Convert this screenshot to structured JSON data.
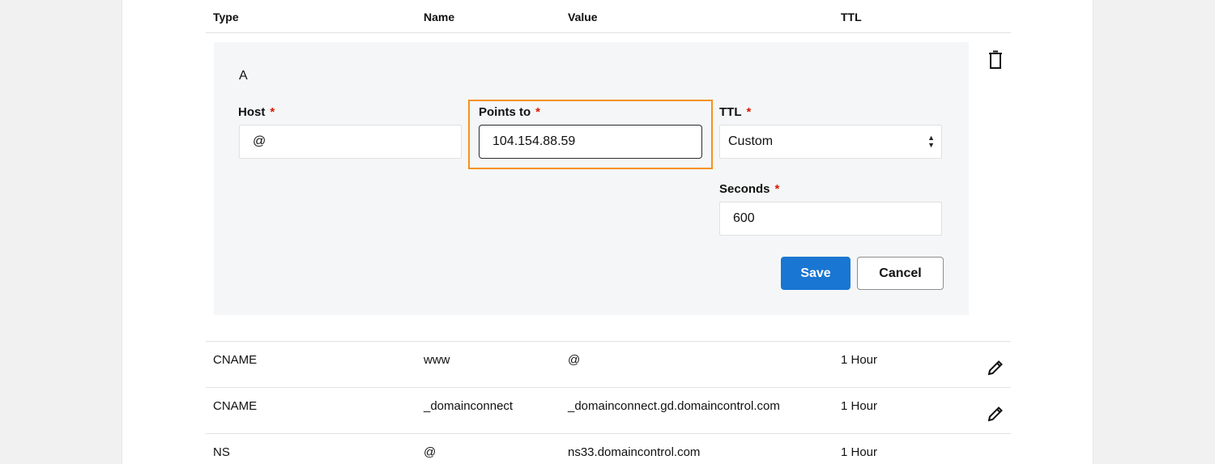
{
  "table": {
    "headers": {
      "type": "Type",
      "name": "Name",
      "value": "Value",
      "ttl": "TTL"
    },
    "rows": [
      {
        "type": "CNAME",
        "name": "www",
        "value": "@",
        "ttl": "1 Hour"
      },
      {
        "type": "CNAME",
        "name": "_domainconnect",
        "value": "_domainconnect.gd.domaincontrol.com",
        "ttl": "1 Hour"
      },
      {
        "type": "NS",
        "name": "@",
        "value": "ns33.domaincontrol.com",
        "ttl": "1 Hour"
      }
    ]
  },
  "editor": {
    "record_type": "A",
    "required_mark": "*",
    "host": {
      "label": "Host",
      "value": "@"
    },
    "points_to": {
      "label": "Points to",
      "value": "104.154.88.59"
    },
    "ttl": {
      "label": "TTL",
      "selected": "Custom"
    },
    "seconds": {
      "label": "Seconds",
      "value": "600"
    },
    "save_label": "Save",
    "cancel_label": "Cancel"
  },
  "icons": {
    "delete": "trash-icon",
    "edit": "pencil-icon"
  },
  "colors": {
    "primary_button": "#1976d2",
    "required": "#db1802",
    "highlight": "#f5921e",
    "panel_bg": "#f5f6f7"
  }
}
